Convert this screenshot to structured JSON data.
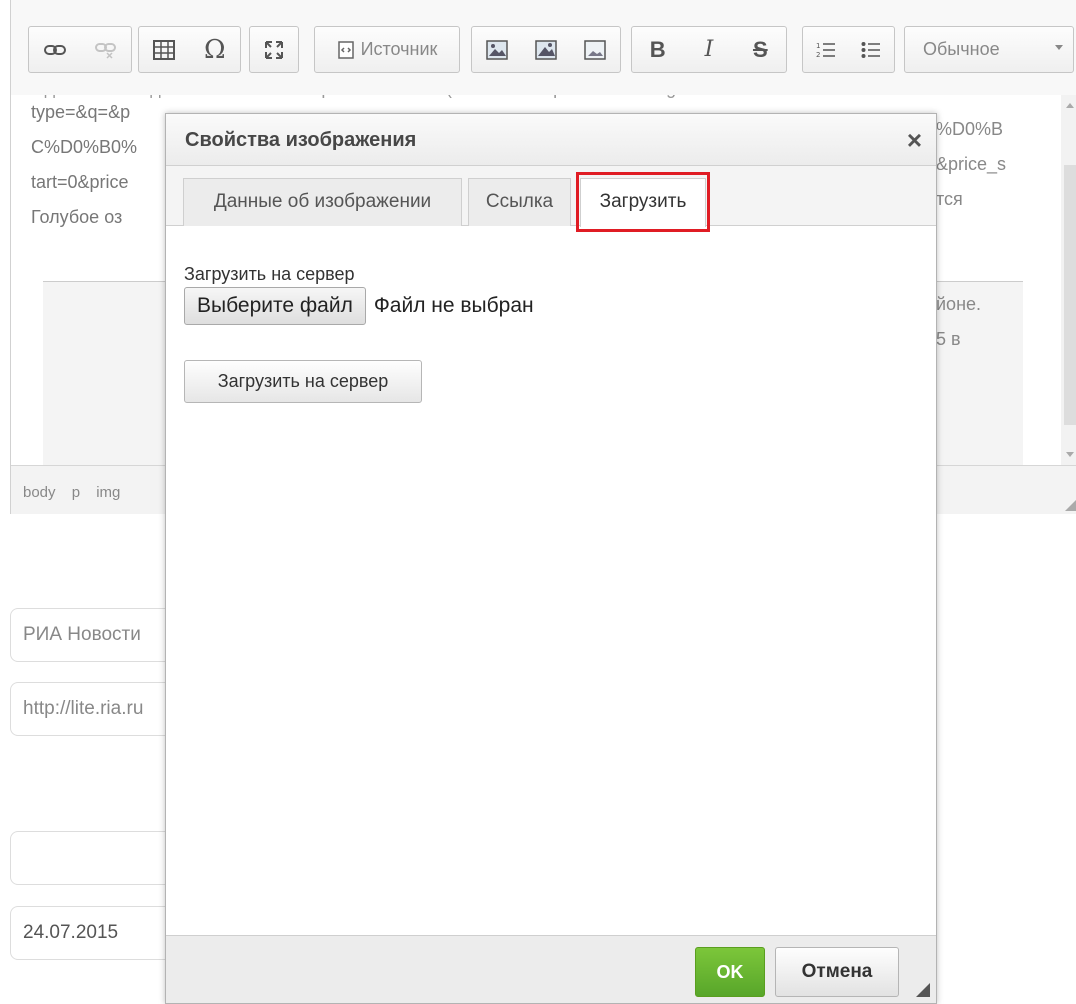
{
  "toolbar": {
    "link_icon": "link-icon",
    "unlink_icon": "unlink-icon",
    "table_icon": "table-icon",
    "special_char_icon": "omega-icon",
    "maximize_icon": "maximize-icon",
    "source_label": "Источник",
    "bold": "B",
    "italic": "I",
    "strike": "S",
    "format_value": "Обычное"
  },
  "content": {
    "cut_line": "Одним из загадочных мест в Самарской области (ССЫЛКА https://tourcatalog.ru/search?",
    "line1_left": "type=&q=&p",
    "line1_right": "%D0%B",
    "line2_left": "C%D0%B0%",
    "line2_right": "&price_s",
    "line3_left": "tart=0&price",
    "line3_right": "тся",
    "line4_left": "Голубое оз",
    "line5_right": "йоне.",
    "line6_right": "5 в"
  },
  "pathbar": [
    "body",
    "p",
    "img"
  ],
  "fields": {
    "source": "РИА Новости",
    "url": "http://lite.ria.ru",
    "empty": "",
    "date": "24.07.2015"
  },
  "dialog": {
    "title": "Свойства изображения",
    "close": "×",
    "tabs": [
      "Данные об изображении",
      "Ссылка",
      "Загрузить"
    ],
    "active_tab": "Загрузить",
    "upload_label": "Загрузить на сервер",
    "file_button": "Выберите файл",
    "file_status": "Файл не выбран",
    "upload_button": "Загрузить на сервер",
    "ok": "OK",
    "cancel": "Отмена",
    "highlight_color": "#e01c24",
    "ok_color": "#6cb833"
  }
}
